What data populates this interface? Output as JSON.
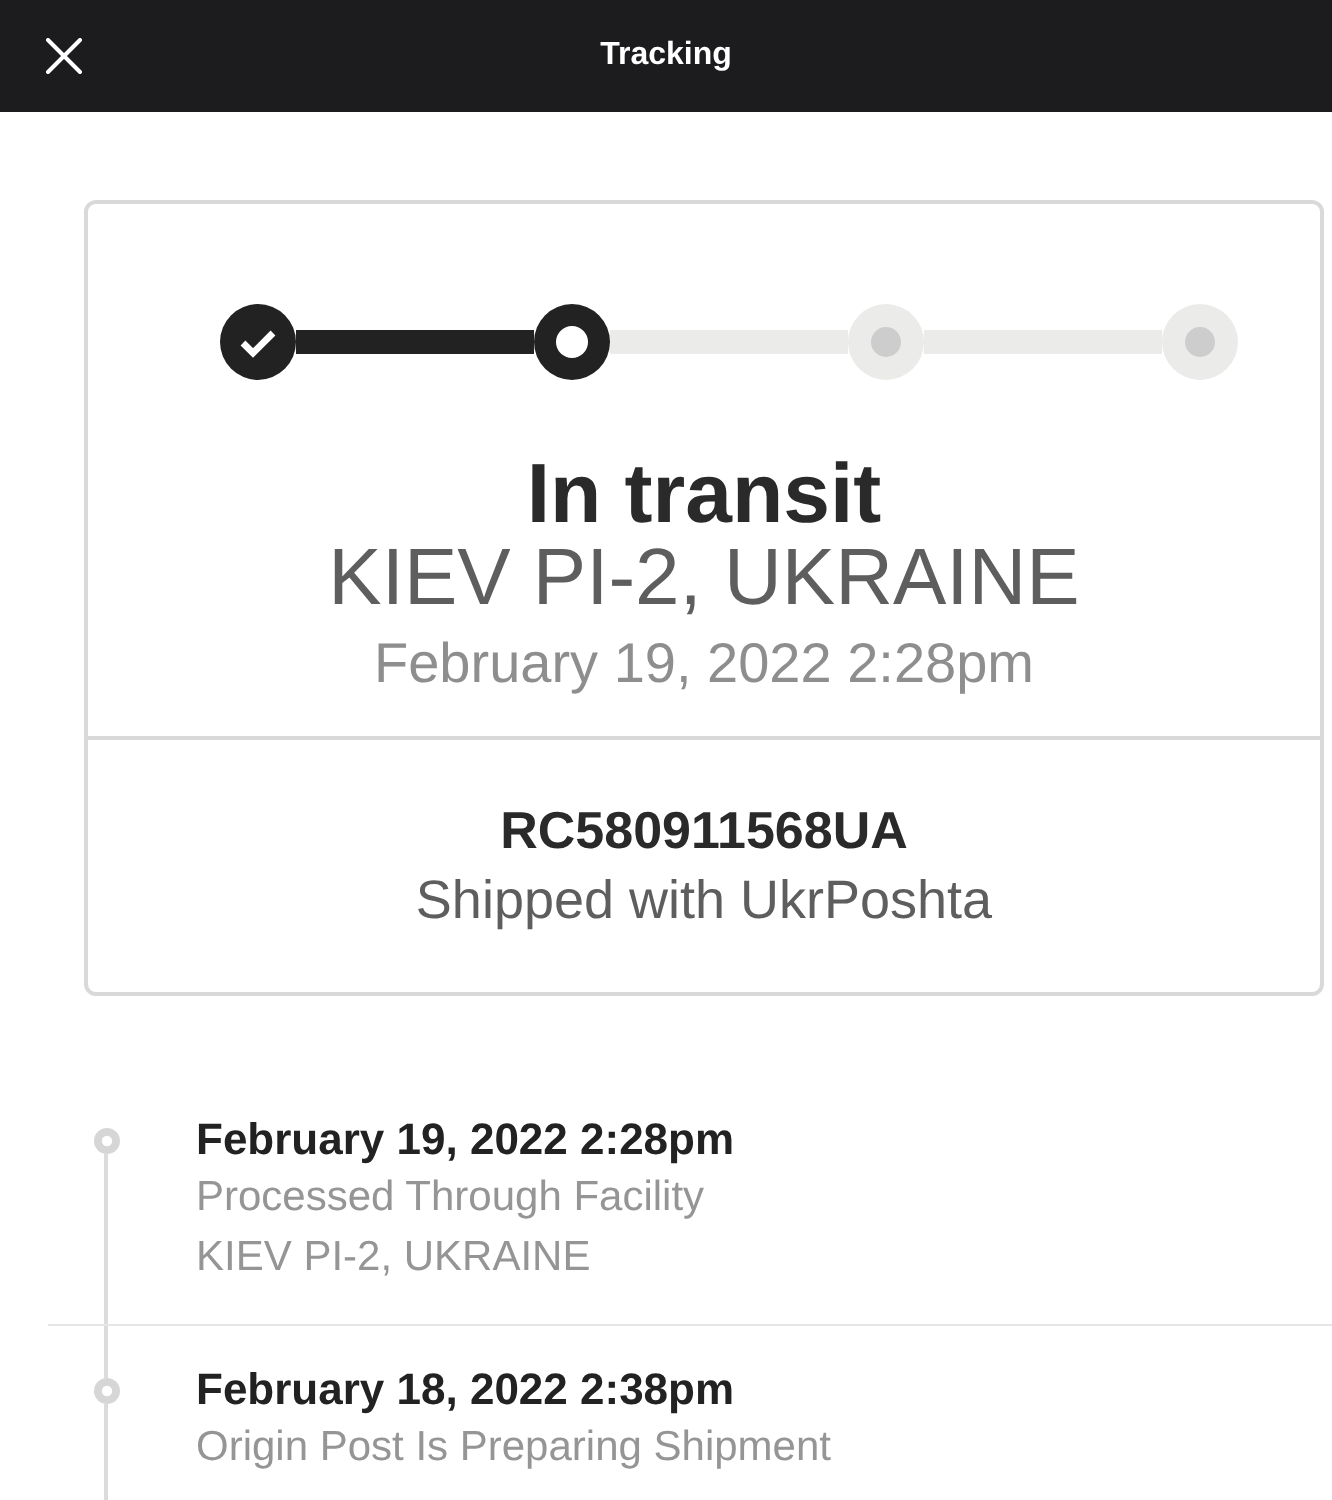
{
  "header": {
    "title": "Tracking"
  },
  "summary": {
    "steps": [
      {
        "kind": "done"
      },
      {
        "kind": "current"
      },
      {
        "kind": "pending"
      },
      {
        "kind": "pending"
      }
    ],
    "status": "In transit",
    "location": "KIEV PI-2, UKRAINE",
    "date": "February 19, 2022 2:28pm",
    "tracking_number": "RC580911568UA",
    "carrier": "Shipped with UkrPoshta"
  },
  "events": [
    {
      "date": "February 19, 2022 2:28pm",
      "description": "Processed Through Facility",
      "location": "KIEV PI-2, UKRAINE"
    },
    {
      "date": "February 18, 2022 2:38pm",
      "description": "Origin Post Is Preparing Shipment"
    }
  ]
}
